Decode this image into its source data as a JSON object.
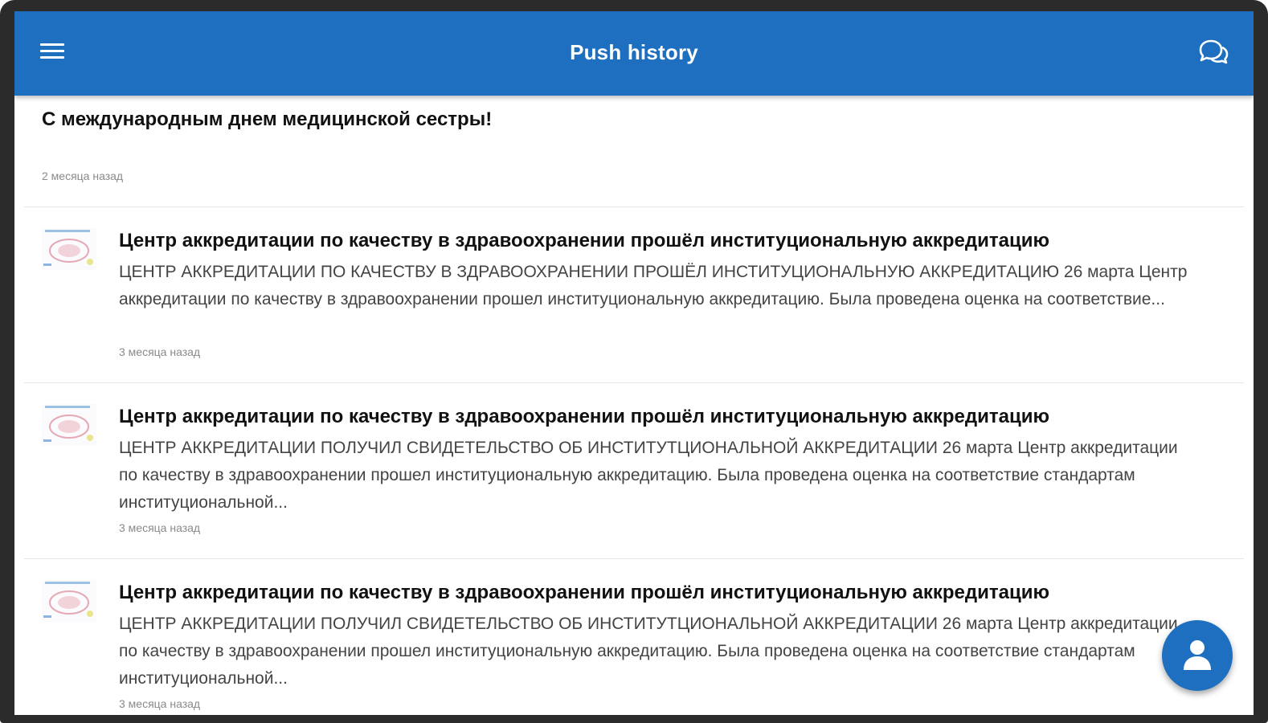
{
  "app_bar": {
    "title": "Push history",
    "menu_icon": "hamburger-menu-icon",
    "chat_icon": "chat-bubbles-icon",
    "color": "#1e6fbf"
  },
  "items": [
    {
      "title": "С международным днем медицинской сестры!",
      "time": "2 месяца назад"
    },
    {
      "title": "Центр аккредитации по качеству в здравоохранении прошёл институциональную аккредитацию",
      "body": "ЦЕНТР АККРЕДИТАЦИИ ПО КАЧЕСТВУ В ЗДРАВООХРАНЕНИИ ПРОШЁЛ ИНСТИТУЦИОНАЛЬНУЮ АККРЕДИТАЦИЮ 26 марта Центр аккредитации по качеству в здравоохранении  прошел институциональную аккредитацию. Была проведена оценка на соответствие...",
      "time": "3 месяца назад"
    },
    {
      "title": "Центр аккредитации по качеству в здравоохранении прошёл институциональную аккредитацию",
      "body": "ЦЕНТР АККРЕДИТАЦИИ ПОЛУЧИЛ СВИДЕТЕЛЬСТВО ОБ ИНСТИТУТЦИОНАЛЬНОЙ АККРЕДИТАЦИИ 26 марта Центр аккредитации по качеству в здравоохранении  прошел институциональную аккредитацию. Была проведена оценка на соответствие стандартам институциональной...",
      "time": "3 месяца назад"
    },
    {
      "title": "Центр аккредитации по качеству в здравоохранении прошёл институциональную аккредитацию",
      "body": "ЦЕНТР АККРЕДИТАЦИИ ПОЛУЧИЛ СВИДЕТЕЛЬСТВО ОБ ИНСТИТУТЦИОНАЛЬНОЙ АККРЕДИТАЦИИ 26 марта Центр аккредитации по качеству в здравоохранении  прошел институциональную аккредитацию. Была проведена оценка на соответствие стандартам институциональной...",
      "time": "3 месяца назад"
    }
  ],
  "fab": {
    "icon": "person-icon"
  }
}
